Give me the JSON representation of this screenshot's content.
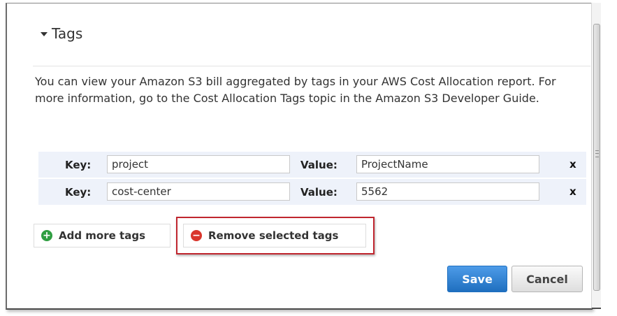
{
  "section": {
    "title": "Tags",
    "description": "You can view your Amazon S3 bill aggregated by tags in your AWS Cost Allocation report. For more information, go to the Cost Allocation Tags topic in the Amazon S3 Developer Guide."
  },
  "tags": {
    "key_label": "Key:",
    "value_label": "Value:",
    "remove_label": "x",
    "rows": [
      {
        "key": "project",
        "value": "ProjectName"
      },
      {
        "key": "cost-center",
        "value": "5562"
      }
    ]
  },
  "actions": {
    "add_more_tags": "Add more tags",
    "remove_selected_tags": "Remove selected tags",
    "save": "Save",
    "cancel": "Cancel",
    "plus_icon": "+",
    "minus_icon": "−"
  },
  "colors": {
    "save_button": "#1f6fbf",
    "highlight_border": "#c0262f",
    "add_icon": "#2f9e41",
    "remove_icon": "#d9362c",
    "row_background": "#eef2fa"
  },
  "icons": {
    "collapse": "triangle-down-icon",
    "add": "plus-circle-icon",
    "remove": "minus-circle-icon"
  }
}
